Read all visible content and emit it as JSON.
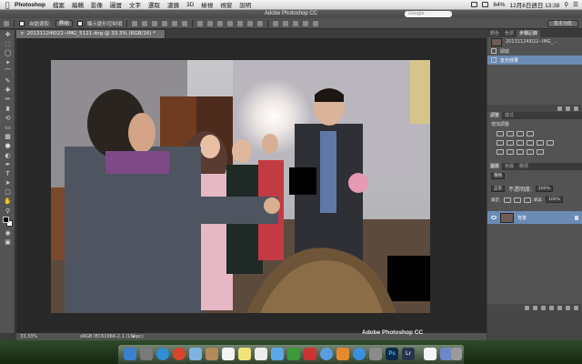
{
  "menubar": {
    "apple": "",
    "app_name": "Photoshop",
    "items": [
      "檔案",
      "編輯",
      "影像",
      "圖層",
      "文字",
      "選取",
      "濾鏡",
      "3D",
      "檢視",
      "視窗",
      "說明"
    ],
    "battery": "64%",
    "clock": "12月8日週日 13:38"
  },
  "title_bar": {
    "title": "Adobe Photoshop CC"
  },
  "search": {
    "placeholder": "Google"
  },
  "options_bar": {
    "auto_select_label": "自動選取:",
    "auto_select_value": "群組",
    "show_transform_label": "顯示變形控制項",
    "workspace": "基本功能"
  },
  "document": {
    "tab_close": "×",
    "tab_title": "20131124I022--IMG_5121.dng @ 33.3% (RGB/16) *"
  },
  "status_bar": {
    "zoom": "33.33%",
    "profile": "sRGB IEC61966-2.1 (16bpc)",
    "arrow": "▸"
  },
  "splash": "Adobe Photoshop CC",
  "history_panel": {
    "tabs": [
      "顏色",
      "色票",
      "步驟記錄"
    ],
    "snapshot": "20131124I022--IMG_...",
    "items": [
      "開啟",
      "去光效果"
    ]
  },
  "adjustments_panel": {
    "tabs": [
      "調整",
      "樣式"
    ],
    "title": "增加調整"
  },
  "layers_panel": {
    "tabs": [
      "圖層",
      "色版",
      "路徑"
    ],
    "kind": "種類",
    "blend_mode": "正常",
    "opacity_label": "不透明度:",
    "opacity_value": "100%",
    "lock_label": "鎖定:",
    "fill_label": "填滿:",
    "fill_value": "100%",
    "layer_name": "背景"
  },
  "tools": [
    "move",
    "marquee",
    "lasso",
    "quick-select",
    "crop",
    "eyedropper",
    "healing",
    "brush",
    "clone-stamp",
    "history-brush",
    "eraser",
    "gradient",
    "blur",
    "dodge",
    "pen",
    "type",
    "path-select",
    "shape",
    "hand",
    "zoom"
  ],
  "dock": [
    "Finder",
    "Launchpad",
    "Safari",
    "Chrome",
    "Mail",
    "Contacts",
    "Calendar",
    "Notes",
    "Reminders",
    "Messages",
    "FaceTime",
    "Photo Booth",
    "iTunes",
    "iBooks",
    "App Store",
    "System Preferences",
    "Ps",
    "Lr",
    "Document",
    "Downloads",
    "Trash"
  ],
  "colors": {
    "accent": "#6b8bb5",
    "panel": "#535353",
    "workspace": "#282828"
  }
}
